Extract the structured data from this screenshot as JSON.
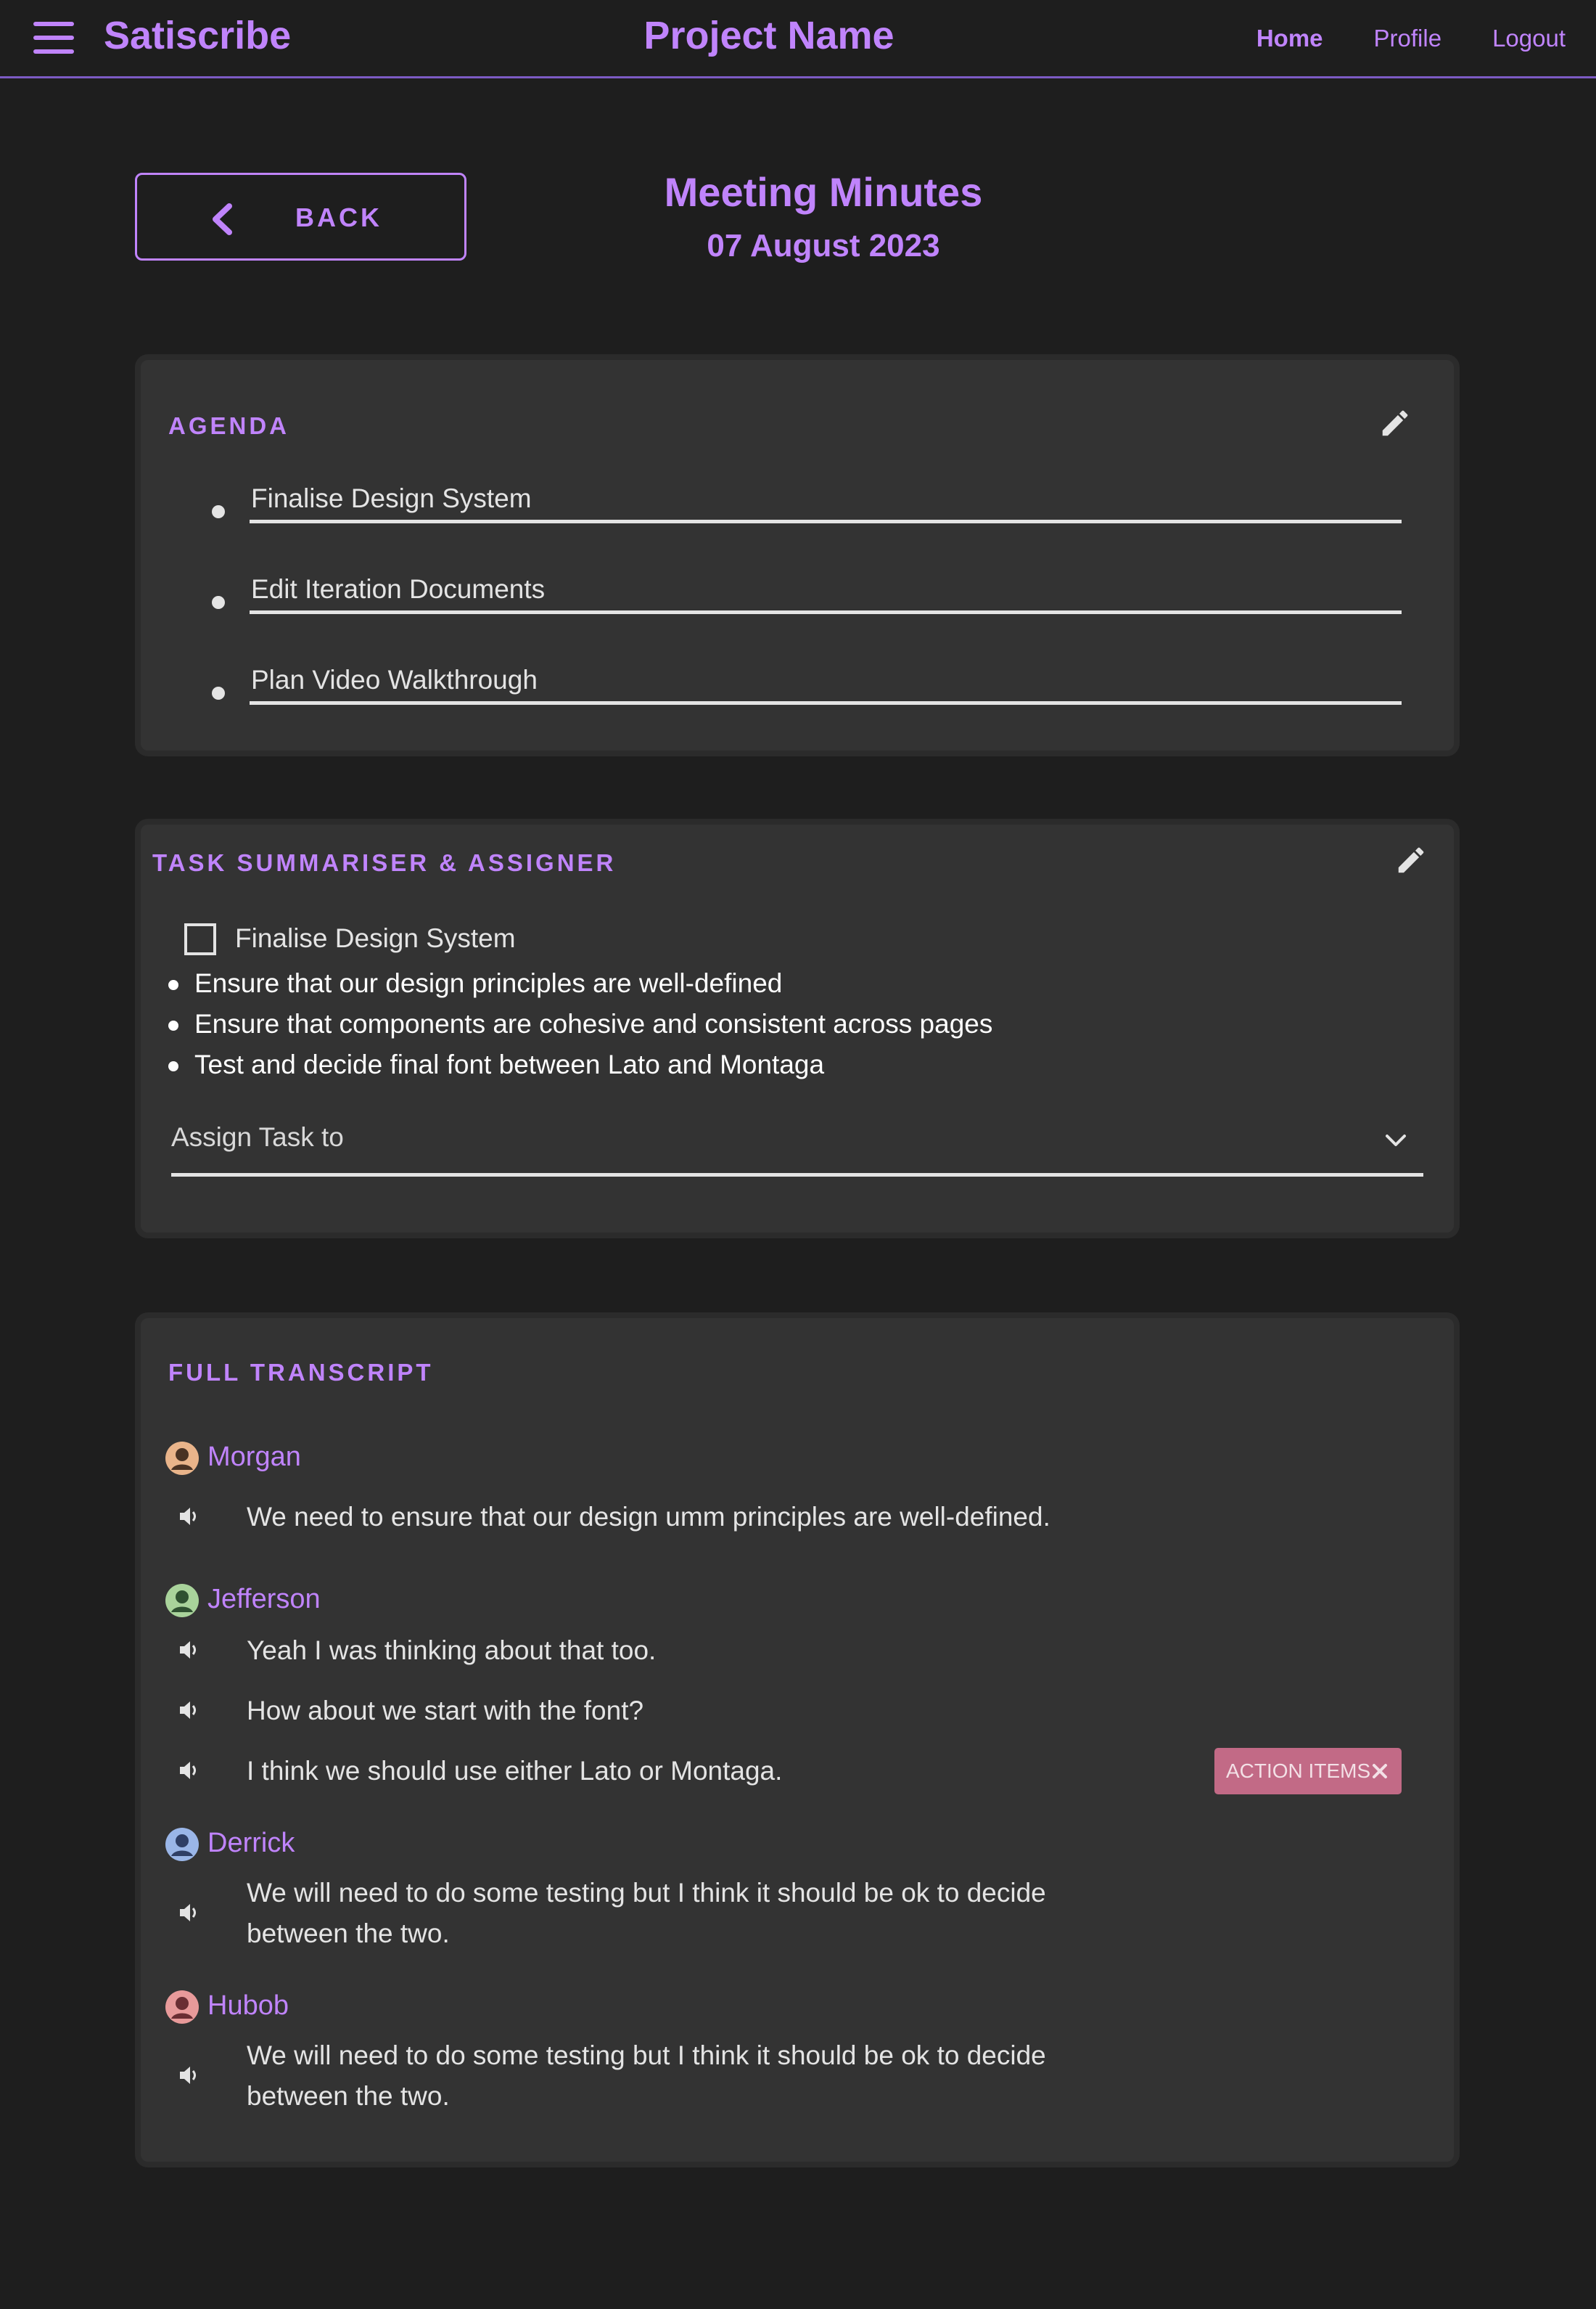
{
  "header": {
    "brand": "Satiscribe",
    "project_name": "Project Name",
    "nav": [
      "Home",
      "Profile",
      "Logout"
    ]
  },
  "page": {
    "back_label": "BACK",
    "title": "Meeting Minutes",
    "date": "07 August 2023"
  },
  "agenda": {
    "title": "AGENDA",
    "items": [
      "Finalise Design System",
      "Edit Iteration Documents",
      "Plan Video Walkthrough"
    ]
  },
  "task": {
    "title": "TASK SUMMARISER & ASSIGNER",
    "task_name": "Finalise Design System",
    "checked": false,
    "bullets": [
      "Ensure that our design principles are well-defined",
      "Ensure that components are cohesive and consistent across pages",
      "Test and decide final font between Lato and Montaga"
    ],
    "assign_placeholder": "Assign Task to"
  },
  "transcript": {
    "title": "FULL TRANSCRIPT",
    "speakers": [
      {
        "name": "Morgan",
        "lines": [
          "We need to ensure that our design umm principles are well-defined."
        ]
      },
      {
        "name": "Jefferson",
        "lines": [
          "Yeah I was thinking about that too.",
          "How about we start with the font?",
          "I think we should use either Lato or Montaga."
        ]
      },
      {
        "name": "Derrick",
        "lines": [
          "We will need to do some testing but I think it should be ok to decide between the two."
        ]
      },
      {
        "name": "Hubob",
        "lines": [
          "We will need to do some testing but I think it should be ok to decide between the two."
        ]
      }
    ],
    "action_badge": "ACTION ITEMS"
  },
  "colors": {
    "accent": "#c084fc",
    "background": "#1e1e1e",
    "card": "#333333",
    "badge": "#c26a86"
  }
}
